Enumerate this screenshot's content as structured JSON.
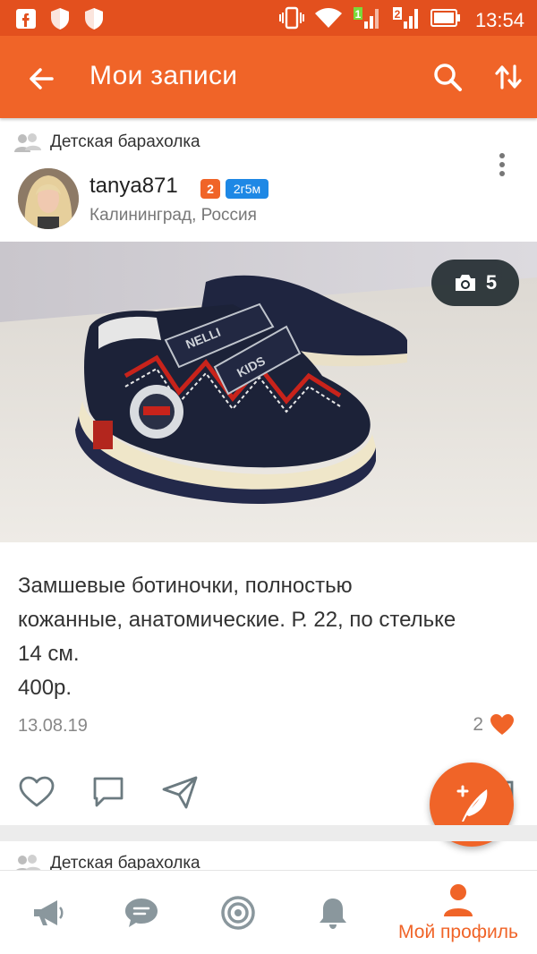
{
  "status_bar": {
    "time": "13:54",
    "sim1": "1",
    "sim2": "2",
    "icons": [
      "facebook-icon",
      "shield-icon",
      "shield-icon",
      "vibrate-icon",
      "wifi-icon",
      "signal-icon",
      "signal-icon",
      "battery-icon"
    ]
  },
  "appbar": {
    "title": "Мои записи",
    "icons": [
      "back-arrow-icon",
      "search-icon",
      "sort-icon"
    ]
  },
  "post": {
    "group": "Детская барахолка",
    "author": {
      "username": "tanya871",
      "badge_level": "2",
      "badge_time": "2г5м",
      "location": "Калининград, Россия"
    },
    "photo_count": "5",
    "text_lines": [
      "Замшевые ботиночки, полностью",
      "кожанные, анатомические. Р. 22, по стельке",
      "14 см.",
      "400р."
    ],
    "date": "13.08.19",
    "likes": "2"
  },
  "next_post": {
    "group": "Детская барахолка"
  },
  "bottom_nav": {
    "items": [
      "megaphone-icon",
      "chat-icon",
      "target-icon",
      "bell-icon",
      "profile-icon"
    ],
    "active_label": "Мой профиль"
  },
  "colors": {
    "status_bar": "#e3501e",
    "appbar": "#f06428",
    "accent": "#f06428",
    "badge_blue": "#1e88e5"
  }
}
